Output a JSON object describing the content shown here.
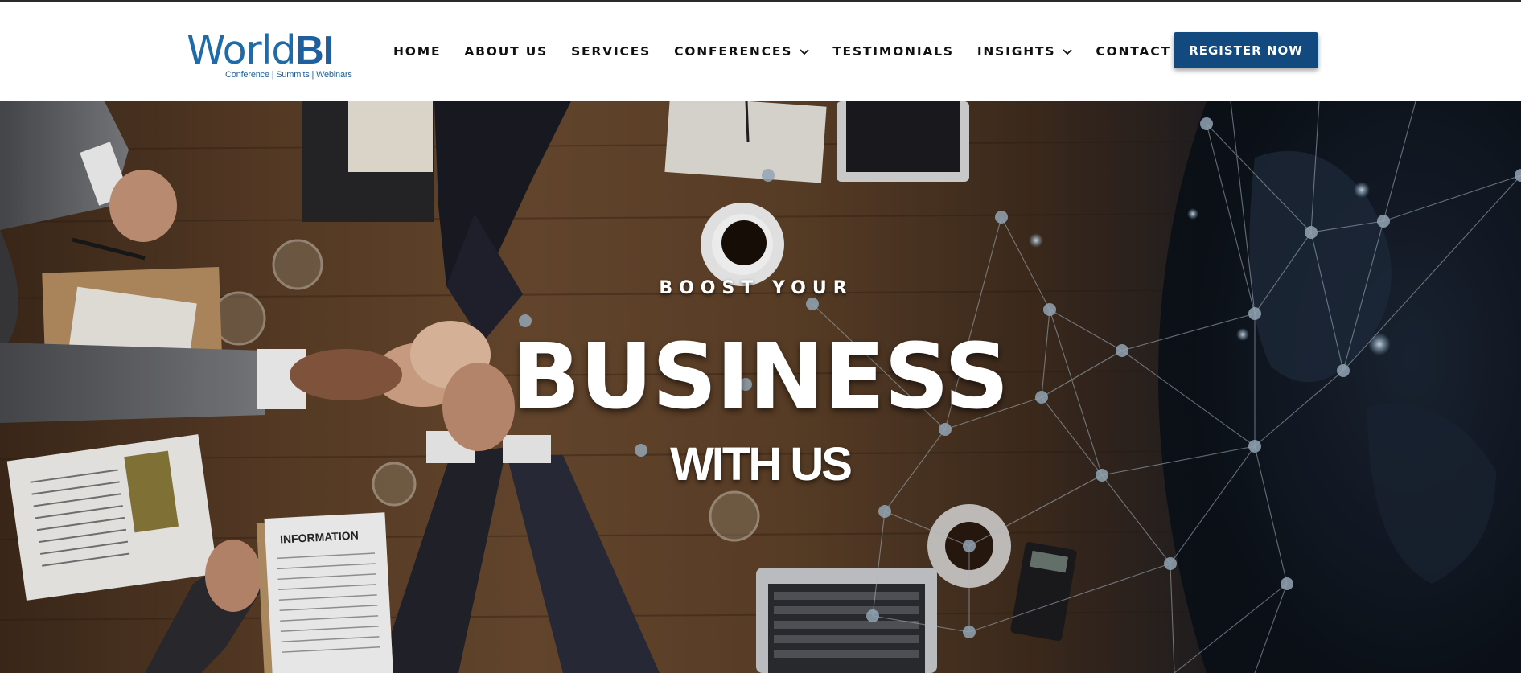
{
  "brand": {
    "name_part1": "World",
    "name_part2": "BI",
    "tagline": "Conference | Summits | Webinars"
  },
  "nav": {
    "items": [
      {
        "label": "HOME",
        "has_dropdown": false
      },
      {
        "label": "ABOUT US",
        "has_dropdown": false
      },
      {
        "label": "SERVICES",
        "has_dropdown": false
      },
      {
        "label": "CONFERENCES",
        "has_dropdown": true
      },
      {
        "label": "TESTIMONIALS",
        "has_dropdown": false
      },
      {
        "label": "INSIGHTS",
        "has_dropdown": true
      },
      {
        "label": "CONTACT US",
        "has_dropdown": false
      }
    ],
    "cta_label": "REGISTER NOW"
  },
  "hero": {
    "kicker": "BOOST YOUR",
    "headline": "BUSINESS",
    "subheadline": "WITH US",
    "document_heading": "INFORMATION"
  },
  "colors": {
    "brand_blue": "#1f5f9e",
    "button_blue": "#12497f",
    "nav_text": "#111111",
    "hero_text": "#ffffff"
  },
  "icons": {
    "dropdown": "chevron-down-icon"
  }
}
